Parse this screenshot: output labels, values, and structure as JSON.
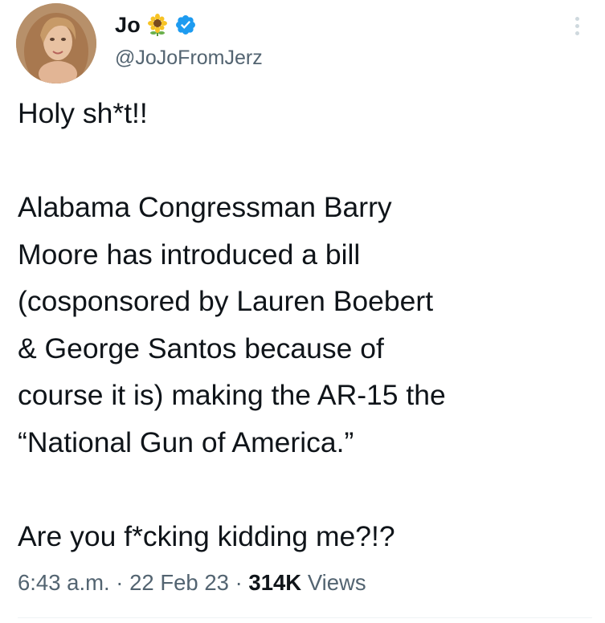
{
  "user": {
    "display_name": "Jo",
    "handle": "@JoJoFromJerz",
    "verified": true,
    "emoji_icon": "sunflower-icon"
  },
  "tweet": {
    "line1": "Holy sh*t!!",
    "paragraph2": "Alabama Congressman Barry\nMoore has introduced a bill\n(cosponsored by Lauren Boebert\n& George Santos because of\ncourse it is) making the AR-15 the\n“National Gun of America.”",
    "line3": "Are you f*cking kidding me?!?"
  },
  "meta": {
    "time": "6:43 a.m.",
    "separator": "·",
    "date": "22 Feb 23",
    "views_count": "314K",
    "views_label": "Views"
  },
  "colors": {
    "verified_blue": "#1d9bf0",
    "secondary_text": "#536471",
    "primary_text": "#0f1419"
  }
}
